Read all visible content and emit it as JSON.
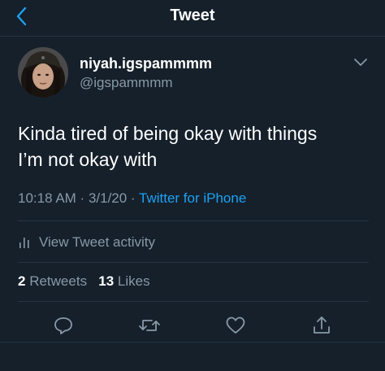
{
  "header": {
    "title": "Tweet",
    "back_icon": "chevron-left-icon"
  },
  "author": {
    "display_name": "niyah.igspammmm",
    "handle": "@igspammmm",
    "menu_icon": "chevron-down-icon"
  },
  "tweet": {
    "text_line1": "Kinda tired of being okay with things",
    "text_line2": "I’m not okay with",
    "time": "10:18 AM",
    "sep1": " · ",
    "date": "3/1/20",
    "sep2": " · ",
    "source": "Twitter for iPhone"
  },
  "activity": {
    "label": "View Tweet activity",
    "icon": "bar-chart-icon"
  },
  "stats": {
    "retweets_count": "2",
    "retweets_label": "Retweets",
    "likes_count": "13",
    "likes_label": "Likes"
  },
  "actions": [
    "reply-icon",
    "retweet-icon",
    "like-icon",
    "share-icon"
  ],
  "colors": {
    "background": "#15202b",
    "accent": "#1da1f2",
    "secondary_text": "#8899a6",
    "divider": "#253341"
  }
}
